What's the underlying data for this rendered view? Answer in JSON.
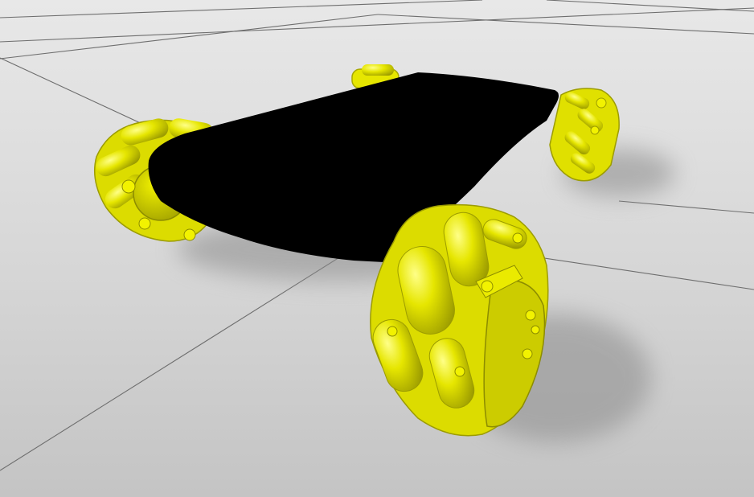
{
  "scene": {
    "colors": {
      "ground_light": "#e8e8e8",
      "ground_mid": "#d6d6d6",
      "ground_dark": "#c4c4c4",
      "grid_line": "#6e6e6e",
      "chassis": "#000000",
      "wheel": "#e6e600",
      "wheel_shadow": "#a8a800",
      "wheel_highlight": "#ffff66",
      "shadow": "#8a8a8a"
    },
    "objects": [
      {
        "name": "chassis-plate"
      },
      {
        "name": "front-left-mecanum-wheel"
      },
      {
        "name": "front-right-mecanum-wheel"
      },
      {
        "name": "rear-left-mecanum-wheel"
      },
      {
        "name": "rear-right-mecanum-wheel"
      }
    ]
  }
}
